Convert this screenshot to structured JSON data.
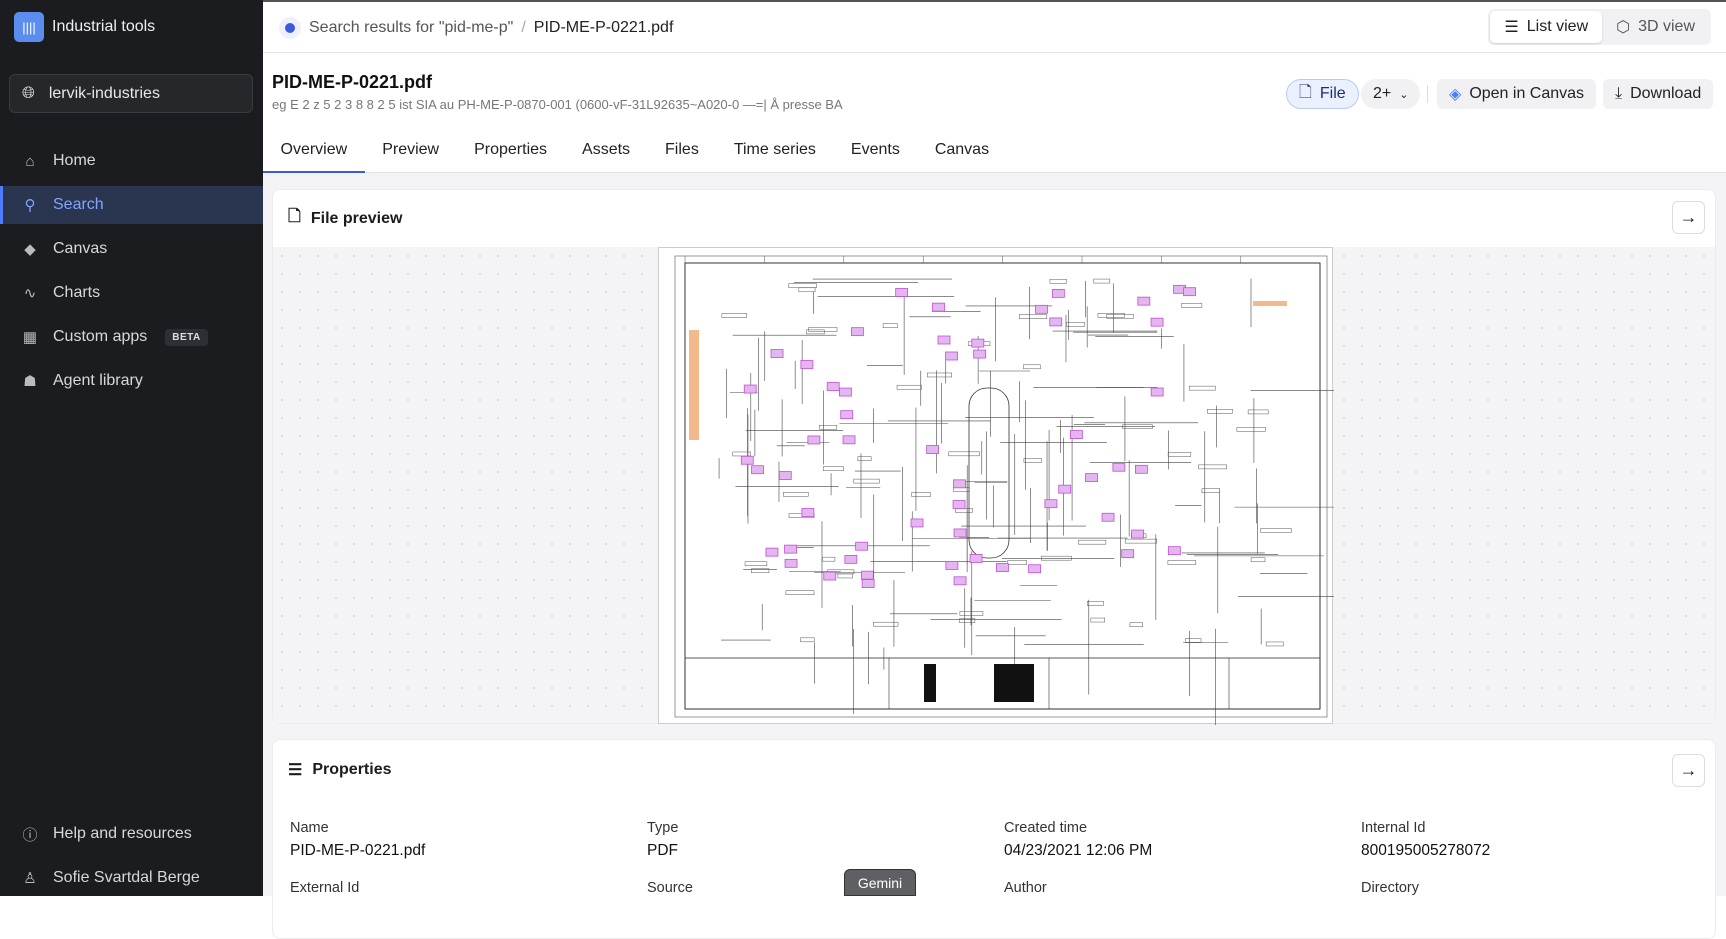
{
  "app": {
    "name": "Industrial tools",
    "org": "lervik-industries"
  },
  "sidebar": {
    "items": [
      {
        "label": "Home"
      },
      {
        "label": "Search"
      },
      {
        "label": "Canvas"
      },
      {
        "label": "Charts"
      },
      {
        "label": "Custom apps",
        "badge": "BETA"
      },
      {
        "label": "Agent library"
      }
    ],
    "help": "Help and resources",
    "user": "Sofie Svartdal Berge"
  },
  "breadcrumb": {
    "parent": "Search results for \"pid-me-p\"",
    "sep": "/",
    "current": "PID-ME-P-0221.pdf"
  },
  "view_toggle": {
    "list": "List view",
    "3d": "3D view"
  },
  "file": {
    "title": "PID-ME-P-0221.pdf",
    "subtitle": "eg E 2 z 5 2 3 8 8 2 5 ist SIA au PH-ME-P-0870-001 (0600-vF-31L92635~A020-0 —=| Å presse BA"
  },
  "actions": {
    "file": "File",
    "more": "2+",
    "open_canvas": "Open in Canvas",
    "download": "Download"
  },
  "tabs": [
    "Overview",
    "Preview",
    "Properties",
    "Assets",
    "Files",
    "Time series",
    "Events",
    "Canvas"
  ],
  "preview": {
    "title": "File preview"
  },
  "properties": {
    "title": "Properties",
    "fields": [
      {
        "label": "Name",
        "value": "PID-ME-P-0221.pdf"
      },
      {
        "label": "Type",
        "value": "PDF"
      },
      {
        "label": "Created time",
        "value": "04/23/2021 12:06 PM"
      },
      {
        "label": "Internal Id",
        "value": "800195005278072"
      },
      {
        "label": "External Id"
      },
      {
        "label": "Source"
      },
      {
        "label": "Author"
      },
      {
        "label": "Directory"
      }
    ]
  },
  "tooltip": "Gemini",
  "colors": {
    "accent": "#3b5bdb",
    "tag": "#c24fd6",
    "sidebar": "#1b1c1f"
  }
}
